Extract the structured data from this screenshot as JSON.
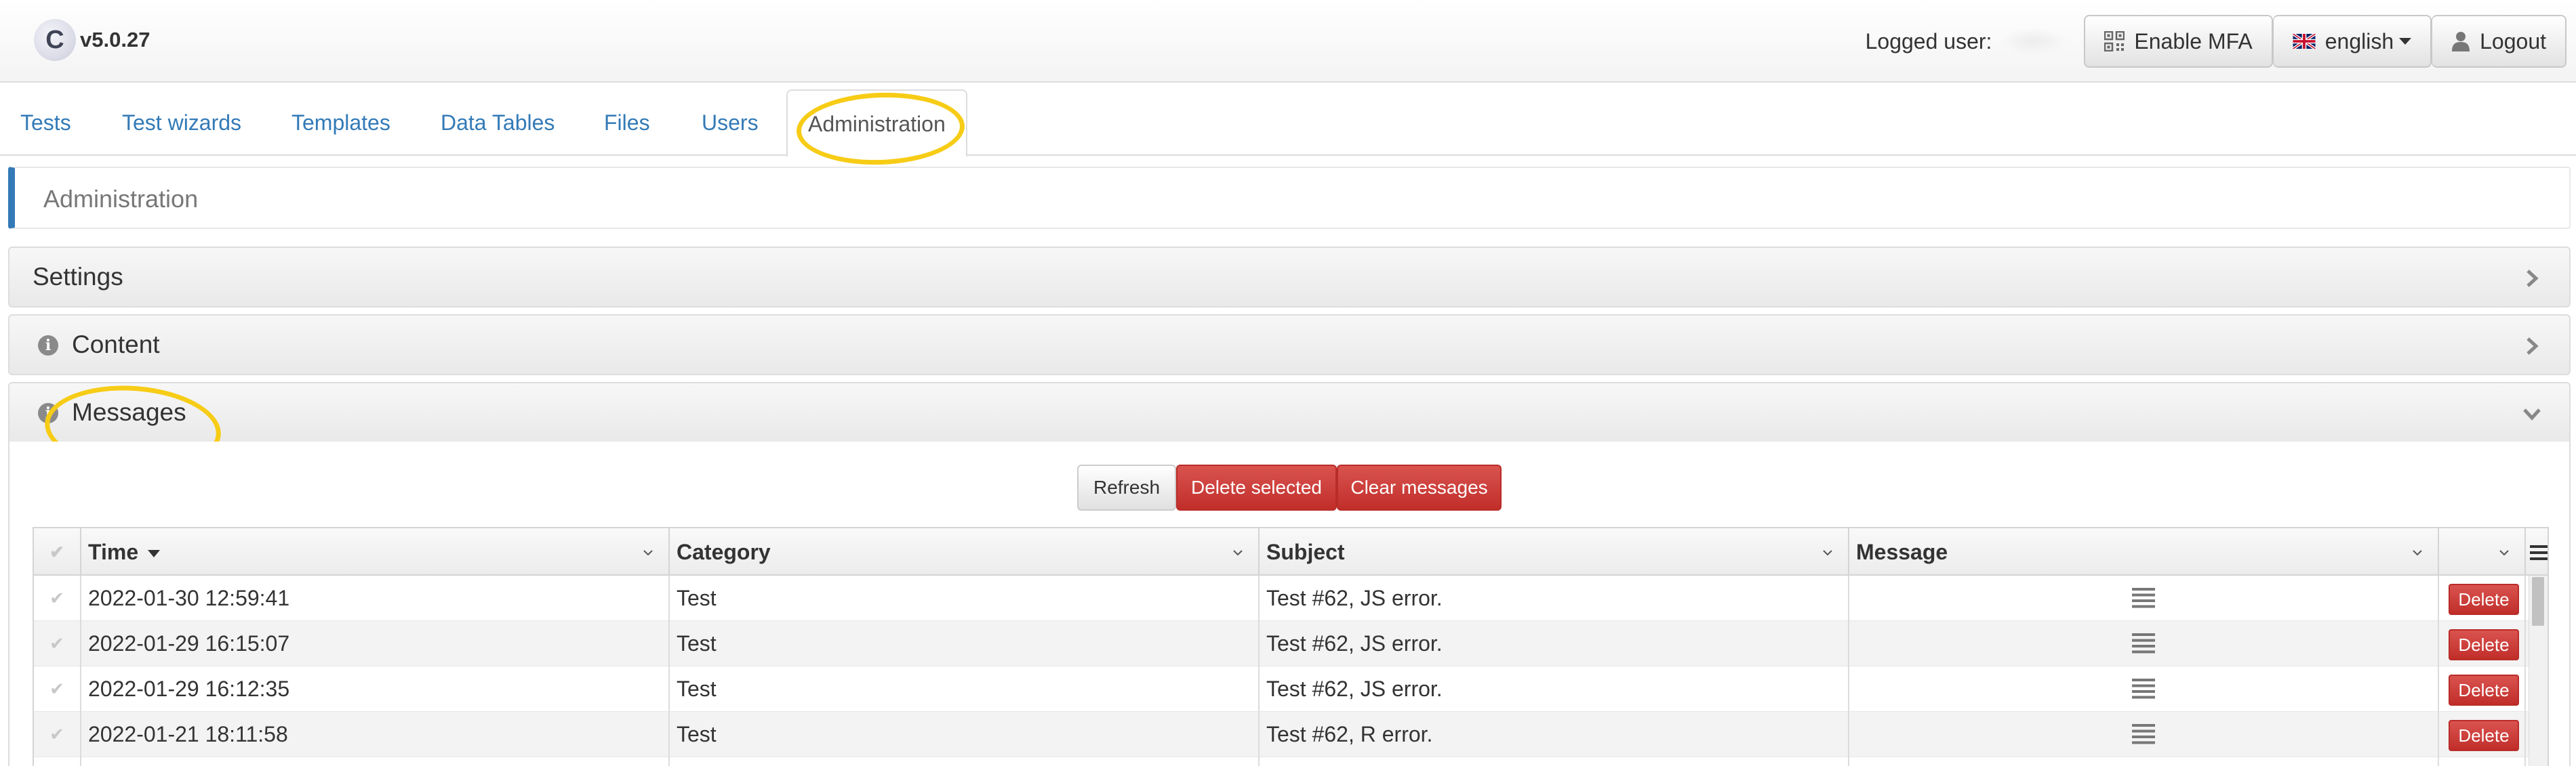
{
  "app": {
    "logo_letter": "C",
    "version": "v5.0.27"
  },
  "navbar": {
    "logged_user_label": "Logged user:",
    "enable_mfa": "Enable MFA",
    "language": "english",
    "logout": "Logout"
  },
  "tabs": [
    "Tests",
    "Test wizards",
    "Templates",
    "Data Tables",
    "Files",
    "Users",
    "Administration"
  ],
  "active_tab": "Administration",
  "page_heading": "Administration",
  "panels": {
    "settings": "Settings",
    "content": "Content",
    "messages": "Messages"
  },
  "actions": {
    "refresh": "Refresh",
    "delete_selected": "Delete selected",
    "clear_messages": "Clear messages"
  },
  "grid": {
    "columns": [
      "Time",
      "Category",
      "Subject",
      "Message"
    ],
    "sorted_by": "Time",
    "rows": [
      {
        "time": "2022-01-30 12:59:41",
        "category": "Test",
        "subject": "Test #62, JS error.",
        "action": "Delete"
      },
      {
        "time": "2022-01-29 16:15:07",
        "category": "Test",
        "subject": "Test #62, JS error.",
        "action": "Delete"
      },
      {
        "time": "2022-01-29 16:12:35",
        "category": "Test",
        "subject": "Test #62, JS error.",
        "action": "Delete"
      },
      {
        "time": "2022-01-21 18:11:58",
        "category": "Test",
        "subject": "Test #62, R error.",
        "action": "Delete"
      }
    ]
  },
  "colors": {
    "link": "#337ab7",
    "danger": "#d9534f",
    "highlight": "#f7cc16"
  }
}
